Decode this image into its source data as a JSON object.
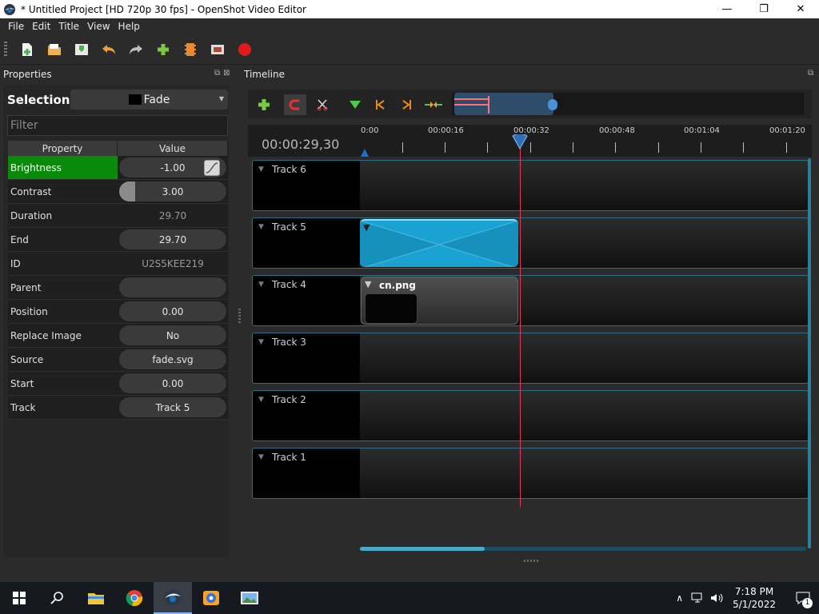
{
  "window": {
    "title": "* Untitled Project [HD 720p 30 fps] - OpenShot Video Editor",
    "minimize": "—",
    "maximize": "❐",
    "close": "✕"
  },
  "menu": [
    "File",
    "Edit",
    "Title",
    "View",
    "Help"
  ],
  "toolbar_icons": [
    "new-project-icon",
    "open-project-icon",
    "save-project-icon",
    "undo-icon",
    "redo-icon",
    "import-files-icon",
    "profile-icon",
    "fullscreen-icon",
    "export-video-icon"
  ],
  "properties": {
    "title": "Properties",
    "selection_label": "Selection:",
    "selection_value": "Fade",
    "filter_placeholder": "Filter",
    "col_property": "Property",
    "col_value": "Value",
    "rows": [
      {
        "name": "Brightness",
        "value": "-1.00"
      },
      {
        "name": "Contrast",
        "value": "3.00"
      },
      {
        "name": "Duration",
        "value": "29.70"
      },
      {
        "name": "End",
        "value": "29.70"
      },
      {
        "name": "ID",
        "value": "U2S5KEE219"
      },
      {
        "name": "Parent",
        "value": ""
      },
      {
        "name": "Position",
        "value": "0.00"
      },
      {
        "name": "Replace Image",
        "value": "No"
      },
      {
        "name": "Source",
        "value": "fade.svg"
      },
      {
        "name": "Start",
        "value": "0.00"
      },
      {
        "name": "Track",
        "value": "Track 5"
      }
    ]
  },
  "timeline": {
    "title": "Timeline",
    "timecode": "00:00:29,30",
    "ruler_labels": [
      "0:00",
      "00:00:16",
      "00:00:32",
      "00:00:48",
      "00:01:04",
      "00:01:20"
    ],
    "tracks": [
      {
        "name": "Track 6"
      },
      {
        "name": "Track 5",
        "clip": "",
        "clip_kind": "fade"
      },
      {
        "name": "Track 4",
        "clip": "cn.png",
        "clip_kind": "image"
      },
      {
        "name": "Track 3"
      },
      {
        "name": "Track 2"
      },
      {
        "name": "Track 1"
      }
    ],
    "playhead_seconds": 29.3,
    "colors": {
      "track_border": "#2e6f86",
      "fade_clip": "#1aa2d2",
      "playhead": "#e23a5a",
      "active_property": "#0a8a0a"
    }
  },
  "taskbar": {
    "time": "7:18 PM",
    "date": "5/1/2022",
    "notification_count": "1",
    "apps": [
      "start-icon",
      "search-icon",
      "file-explorer-icon",
      "chrome-icon",
      "openshot-icon",
      "app-icon",
      "photo-app-icon"
    ]
  }
}
